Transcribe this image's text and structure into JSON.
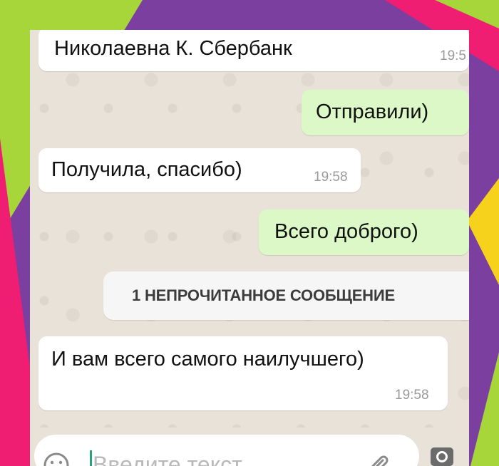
{
  "messages": [
    {
      "id": "m1",
      "direction": "in",
      "text": "Николаевна К. Сбербанк",
      "time": "19:5"
    },
    {
      "id": "m2",
      "direction": "out",
      "text": "Отправили)"
    },
    {
      "id": "m3",
      "direction": "in",
      "text": "Получила, спасибо)",
      "time": "19:58"
    },
    {
      "id": "m4",
      "direction": "out",
      "text": "Всего доброго)"
    },
    {
      "id": "m5",
      "direction": "in",
      "text": "И вам всего самого наилучшего)",
      "time": "19:58"
    }
  ],
  "unread_banner": {
    "text": "1 НЕПРОЧИТАННОЕ СООБЩЕНИЕ"
  },
  "composer": {
    "placeholder": "Введите текст"
  },
  "colors": {
    "incoming_bubble": "#ffffff",
    "outgoing_bubble": "#dcf8c6",
    "chat_background": "#e9e2d8",
    "frame_purple": "#7b3fa0",
    "accent_green": "#a6d63a",
    "accent_pink": "#ef1e73",
    "accent_yellow": "#f6d21c"
  },
  "icons": [
    "emoji-icon",
    "attach-icon",
    "camera-icon"
  ]
}
